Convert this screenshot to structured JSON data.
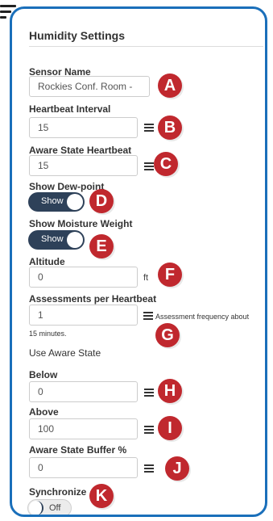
{
  "header": {
    "title": "Humidity Settings"
  },
  "sensor_name": {
    "label": "Sensor Name",
    "value": "Rockies Conf. Room -",
    "badge": "A"
  },
  "heartbeat_interval": {
    "label": "Heartbeat Interval",
    "value": "15",
    "badge": "B"
  },
  "aware_state_heartbeat": {
    "label": "Aware State Heartbeat",
    "value": "15",
    "badge": "C"
  },
  "show_dew_point": {
    "label": "Show Dew-point",
    "toggle": "Show",
    "state": "on",
    "badge": "D"
  },
  "show_moisture_weight": {
    "label": "Show Moisture Weight",
    "toggle": "Show",
    "state": "on",
    "badge": "E"
  },
  "altitude": {
    "label": "Altitude",
    "value": "0",
    "unit": "ft",
    "badge": "F"
  },
  "assessments_per_heartbeat": {
    "label": "Assessments per Heartbeat",
    "value": "1",
    "hint": "Assessment frequency about",
    "hint_cont": "15 minutes.",
    "badge": "G"
  },
  "use_aware_state": {
    "label": "Use Aware State"
  },
  "below": {
    "label": "Below",
    "value": "0",
    "badge": "H"
  },
  "above": {
    "label": "Above",
    "value": "100",
    "badge": "I"
  },
  "aware_state_buffer": {
    "label": "Aware State Buffer %",
    "value": "0",
    "badge": "J"
  },
  "synchronize": {
    "label": "Synchronize",
    "toggle": "Off",
    "state": "off",
    "badge": "K"
  },
  "colors": {
    "frame": "#1a6fba",
    "badge": "#c0282e",
    "toggle_on": "#2e4159"
  },
  "icons": {
    "menu": "hamburger-icon",
    "list": "list-icon"
  }
}
